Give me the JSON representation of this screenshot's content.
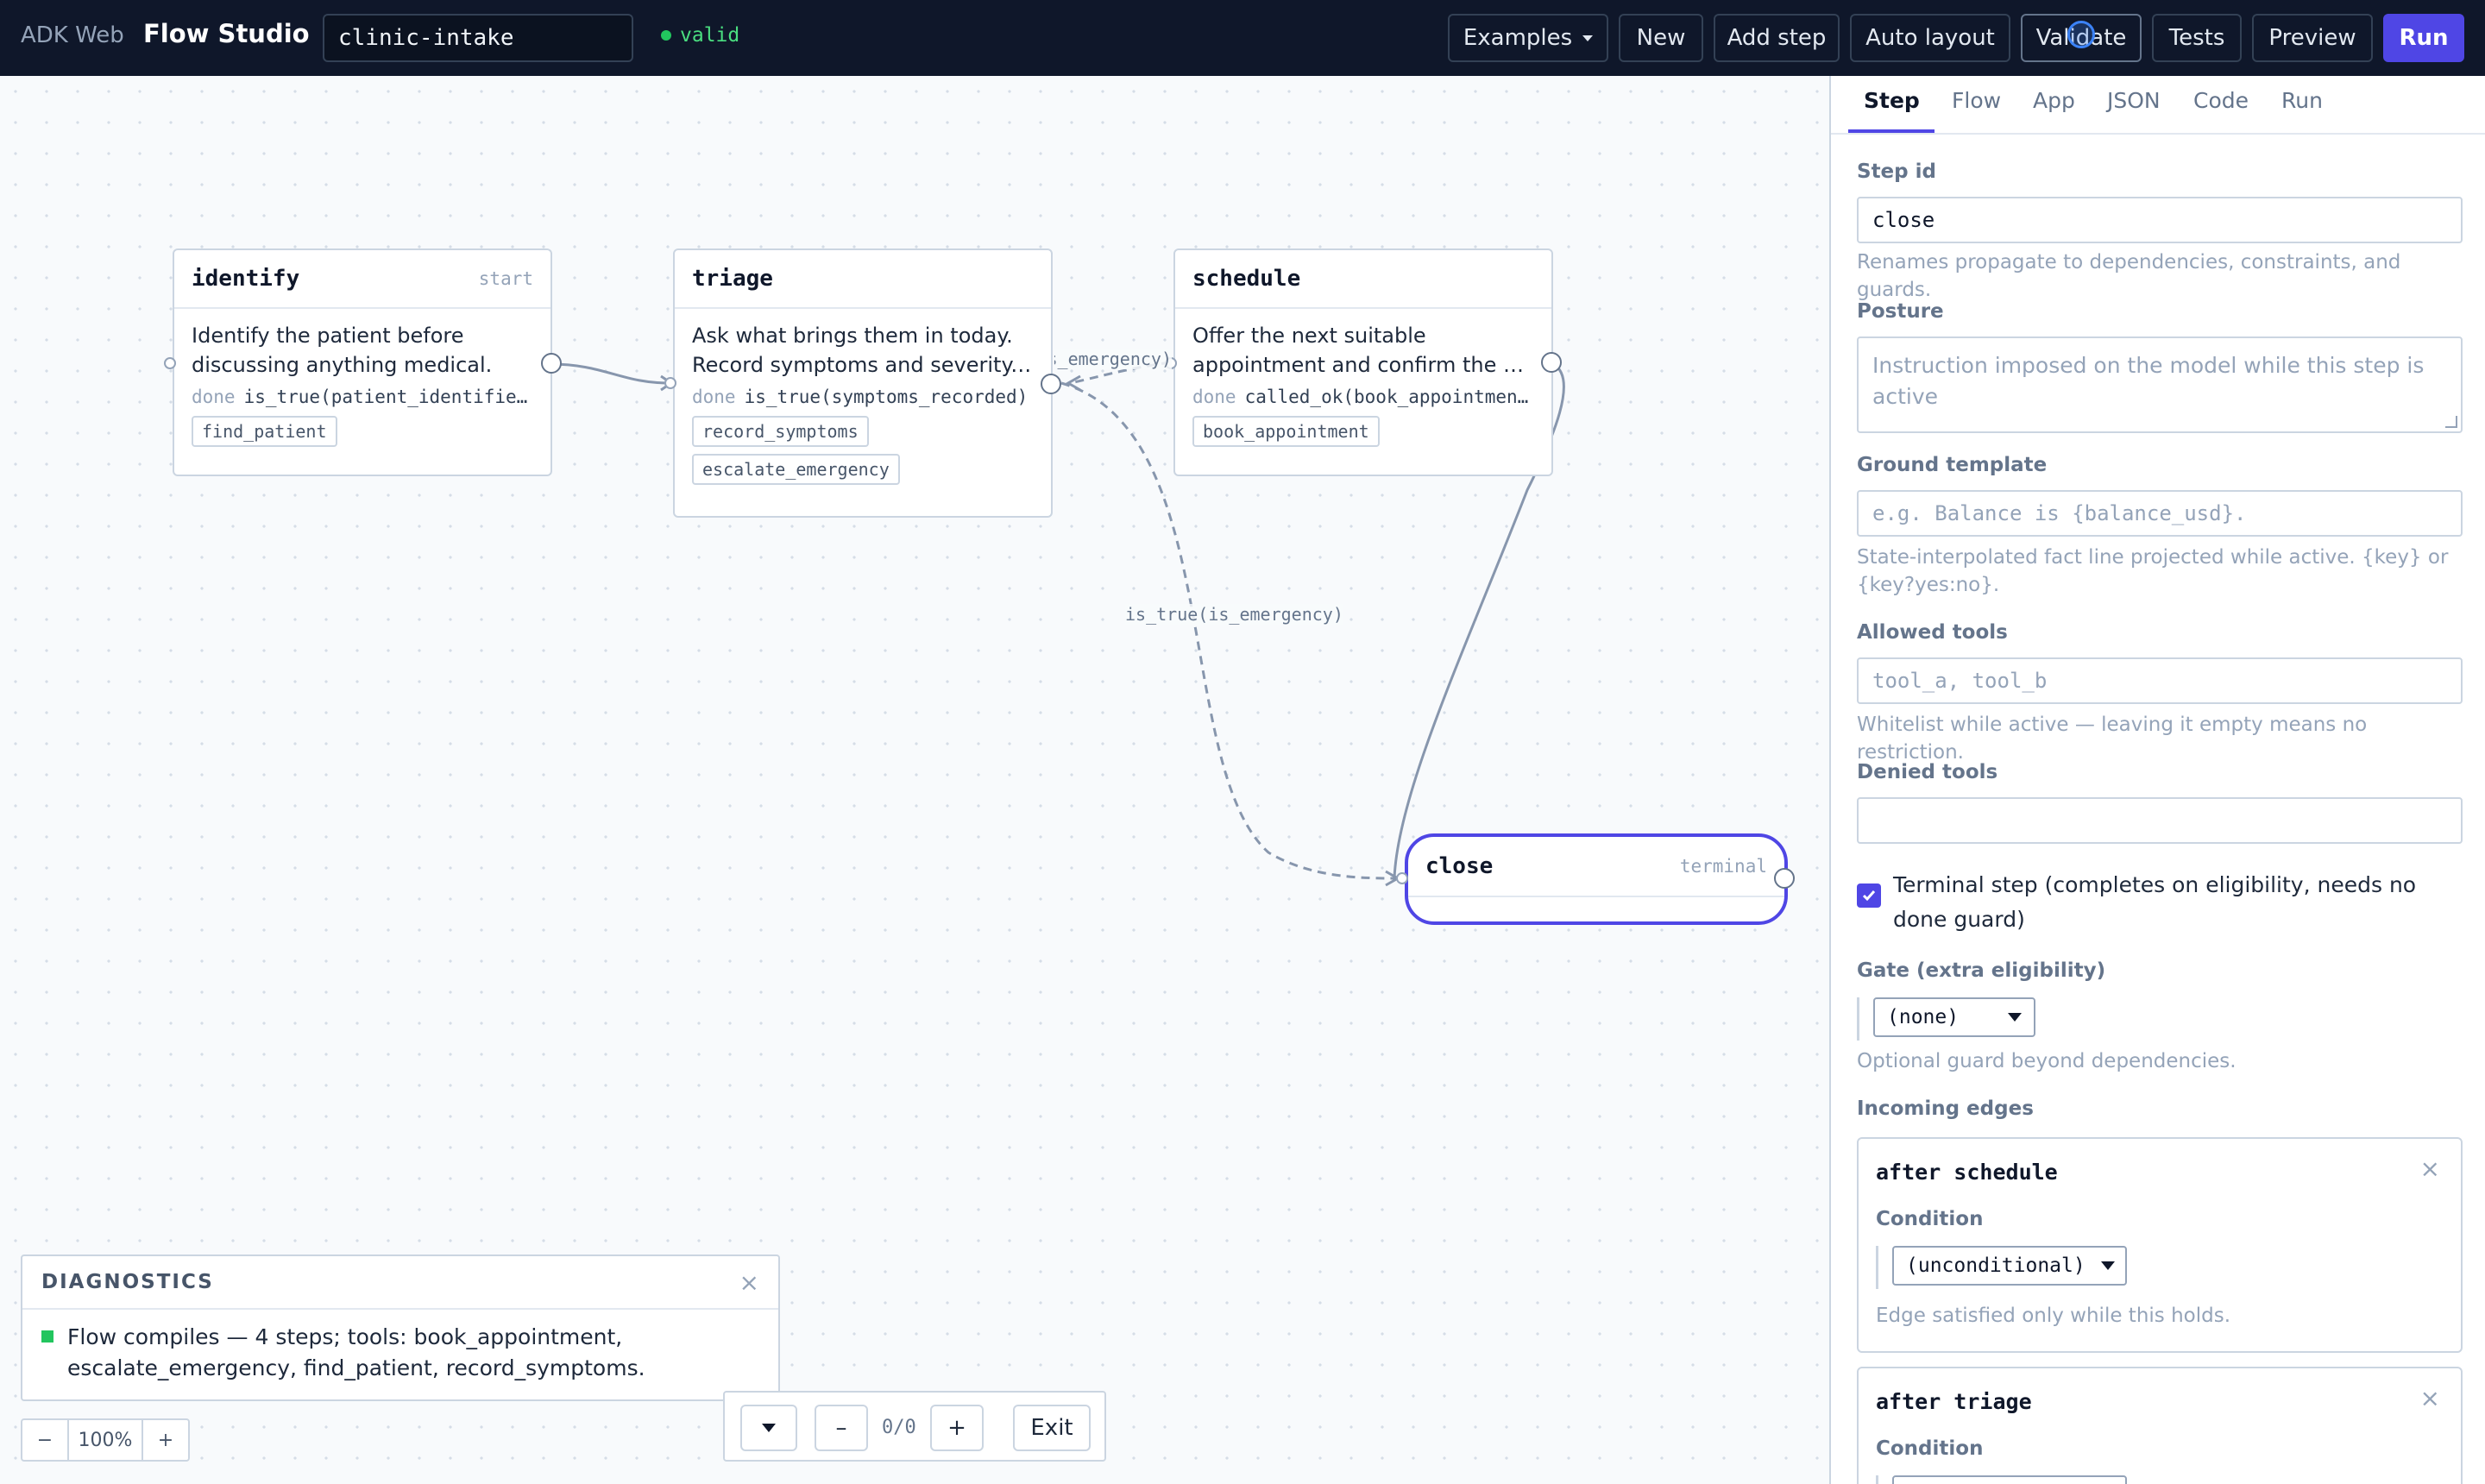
{
  "topbar": {
    "brand_sub": "ADK Web",
    "brand": "Flow Studio",
    "flow_name": "clinic-intake",
    "status": "valid",
    "buttons": {
      "examples": "Examples",
      "new": "New",
      "add_step": "Add step",
      "auto_layout": "Auto layout",
      "validate": "Validate",
      "tests": "Tests",
      "preview": "Preview",
      "run": "Run"
    }
  },
  "nodes": {
    "identify": {
      "title": "identify",
      "tag": "start",
      "desc": [
        "Identify the patient before",
        "discussing anything medical."
      ],
      "done_kw": "done",
      "done_expr": "is_true(patient_identified)",
      "tools": [
        "find_patient"
      ]
    },
    "triage": {
      "title": "triage",
      "tag": "",
      "desc": [
        "Ask what brings them in today.",
        "Record symptoms and severity. Escalate"
      ],
      "done_kw": "done",
      "done_expr": "is_true(symptoms_recorded)",
      "tools": [
        "record_symptoms",
        "escalate_emergency"
      ]
    },
    "schedule": {
      "title": "schedule",
      "tag": "",
      "desc": [
        "Offer the next suitable",
        "appointment and confirm the booking."
      ],
      "done_kw": "done",
      "done_expr": "called_ok(book_appointment)",
      "tools": [
        "book_appointment"
      ]
    },
    "close": {
      "title": "close",
      "tag": "terminal"
    }
  },
  "edges": {
    "triage_schedule_label": "is_true(is_emergency)",
    "triage_close_label": "is_true(is_emergency)"
  },
  "diagnostics": {
    "title": "DIAGNOSTICS",
    "message": "Flow compiles — 4 steps; tools: book_appointment, escalate_emergency, find_patient, record_symptoms."
  },
  "zoom": {
    "minus": "−",
    "value": "100%",
    "plus": "+"
  },
  "findbar": {
    "count": "0/0",
    "prev": "–",
    "next": "+",
    "exit": "Exit"
  },
  "panel": {
    "tabs": [
      "Step",
      "Flow",
      "App",
      "JSON",
      "Code",
      "Run"
    ],
    "step_id_label": "Step id",
    "step_id_value": "close",
    "step_id_help": "Renames propagate to dependencies, constraints, and guards.",
    "posture_label": "Posture",
    "posture_placeholder": "Instruction imposed on the model while this step is active",
    "ground_label": "Ground template",
    "ground_placeholder": "e.g. Balance is {balance_usd}.",
    "ground_help": "State-interpolated fact line projected while active. {key} or {key?yes:no}.",
    "allowed_label": "Allowed tools",
    "allowed_placeholder": "tool_a, tool_b",
    "allowed_help": "Whitelist while active — leaving it empty means no restriction.",
    "denied_label": "Denied tools",
    "denied_value": "",
    "terminal_label": "Terminal step (completes on eligibility, needs no done guard)",
    "terminal_checked": true,
    "gate_label": "Gate (extra eligibility)",
    "gate_value": "(none)",
    "gate_help": "Optional guard beyond dependencies.",
    "incoming_label": "Incoming edges",
    "incoming": [
      {
        "title": "after schedule",
        "cond_label": "Condition",
        "cond_value": "(unconditional)",
        "help": "Edge satisfied only while this holds."
      },
      {
        "title": "after triage",
        "cond_label": "Condition",
        "cond_value": "",
        "help": ""
      }
    ]
  },
  "colors": {
    "accent": "#4f46e5",
    "topbar_bg": "#0f172a",
    "valid_green": "#22c55e",
    "edge": "#8796ad"
  }
}
